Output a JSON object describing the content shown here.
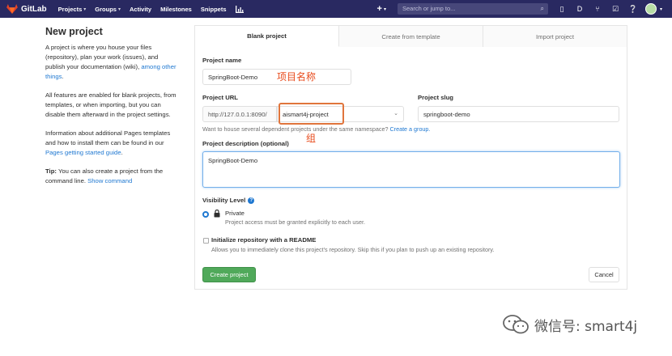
{
  "navbar": {
    "brand": "GitLab",
    "links": [
      {
        "label": "Projects",
        "caret": true
      },
      {
        "label": "Groups",
        "caret": true
      },
      {
        "label": "Activity",
        "caret": false
      },
      {
        "label": "Milestones",
        "caret": false
      },
      {
        "label": "Snippets",
        "caret": false
      }
    ],
    "search_placeholder": "Search or jump to...",
    "plus_label": "+",
    "colors": {
      "bar": "#292961",
      "search": "#47477a"
    }
  },
  "sidebar": {
    "title": "New project",
    "intro": "A project is where you house your files (repository), plan your work (issues), and publish your documentation (wiki),",
    "intro_link": "among other things",
    "intro_end": ".",
    "features": "All features are enabled for blank projects, from templates, or when importing, but you can disable them afterward in the project settings.",
    "pages_text": "Information about additional Pages templates and how to install them can be found in our",
    "pages_link": "Pages getting started guide",
    "pages_end": ".",
    "tip_label": "Tip:",
    "tip_text": "You can also create a project from the command line.",
    "tip_link": "Show command"
  },
  "tabs": [
    {
      "label": "Blank project",
      "active": true
    },
    {
      "label": "Create from template",
      "active": false
    },
    {
      "label": "Import project",
      "active": false
    }
  ],
  "form": {
    "name_label": "Project name",
    "name_value": "SpringBoot-Demo",
    "name_annotation": "项目名称",
    "url_label": "Project URL",
    "url_prefix": "http://127.0.0.1:8090/",
    "url_namespace": "aismart4j-project",
    "group_annotation": "组",
    "slug_label": "Project slug",
    "slug_value": "springboot-demo",
    "namespace_help": "Want to house several dependent projects under the same namespace?",
    "namespace_help_link": "Create a group.",
    "desc_label": "Project description (optional)",
    "desc_value": "SpringBoot-Demo",
    "visibility_label": "Visibility Level",
    "visibility_option": "Private",
    "visibility_help": "Project access must be granted explicitly to each user.",
    "init_label": "Initialize repository with a README",
    "init_help": "Allows you to immediately clone this project's repository. Skip this if you plan to push up an existing repository.",
    "create_button": "Create project",
    "cancel_button": "Cancel"
  },
  "watermark": {
    "text": "微信号: smart4j"
  },
  "colors": {
    "link": "#1f78d1",
    "success": "#50a95a",
    "annotation": "#e84b1c"
  }
}
